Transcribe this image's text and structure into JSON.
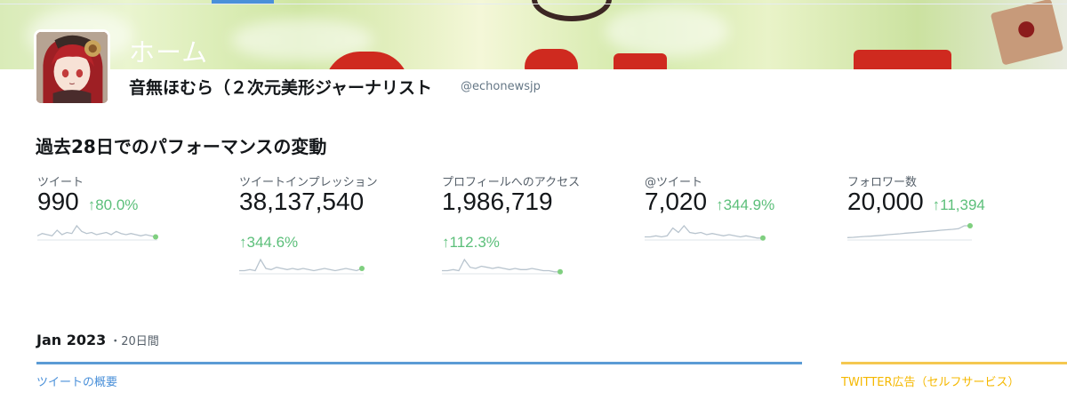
{
  "header": {
    "title": "ホーム",
    "banner_alt": "header-banner-image"
  },
  "profile": {
    "name": "音無ほむら（２次元美形ジャーナリスト",
    "handle": "@echonewsjp"
  },
  "performance": {
    "title": "過去28日でのパフォーマンスの変動",
    "metrics": [
      {
        "label": "ツイート",
        "value": "990",
        "change": "80.0%",
        "sparkline": [
          3,
          5,
          4,
          3,
          8,
          4,
          6,
          5,
          12,
          7,
          5,
          6,
          4,
          5,
          6,
          4,
          7,
          5,
          4,
          5,
          4,
          3,
          4,
          3,
          2
        ]
      },
      {
        "label": "ツイートインプレッション",
        "value": "38,137,540",
        "change": "344.6%",
        "sparkline": [
          2,
          2,
          3,
          2,
          12,
          4,
          3,
          5,
          4,
          3,
          4,
          3,
          4,
          3,
          2,
          3,
          4,
          3,
          2,
          3,
          4,
          3,
          2,
          4
        ]
      },
      {
        "label": "プロフィールへのアクセス",
        "value": "1,986,719",
        "change": "112.3%",
        "sparkline": [
          2,
          2,
          3,
          2,
          12,
          5,
          4,
          6,
          5,
          4,
          5,
          4,
          3,
          4,
          3,
          3,
          4,
          3,
          2,
          2,
          1,
          1
        ]
      },
      {
        "label": "@ツイート",
        "value": "7,020",
        "change": "344.9%",
        "sparkline": [
          2,
          2,
          3,
          2,
          3,
          10,
          6,
          12,
          6,
          5,
          6,
          4,
          5,
          4,
          3,
          4,
          3,
          2,
          3,
          2,
          1,
          1
        ]
      },
      {
        "label": "フォロワー数",
        "value": "20,000",
        "change": "11,394",
        "sparkline": [
          1,
          1.2,
          1.5,
          1.8,
          2,
          2.3,
          2.6,
          3,
          3.3,
          3.6,
          4,
          4.3,
          4.6,
          5,
          5.3,
          5.6,
          6,
          6.3,
          6.6,
          7,
          9,
          9
        ]
      }
    ]
  },
  "period": {
    "label": "Jan 2023",
    "separator": "・",
    "days": "20日間"
  },
  "tabs": {
    "tweets": "ツイートの概要",
    "ads": "TWITTER広告（セルフサービス）"
  },
  "colors": {
    "accent_blue": "#4a90d9",
    "positive_green": "#5cbf7a",
    "ads_yellow": "#f5b800"
  }
}
